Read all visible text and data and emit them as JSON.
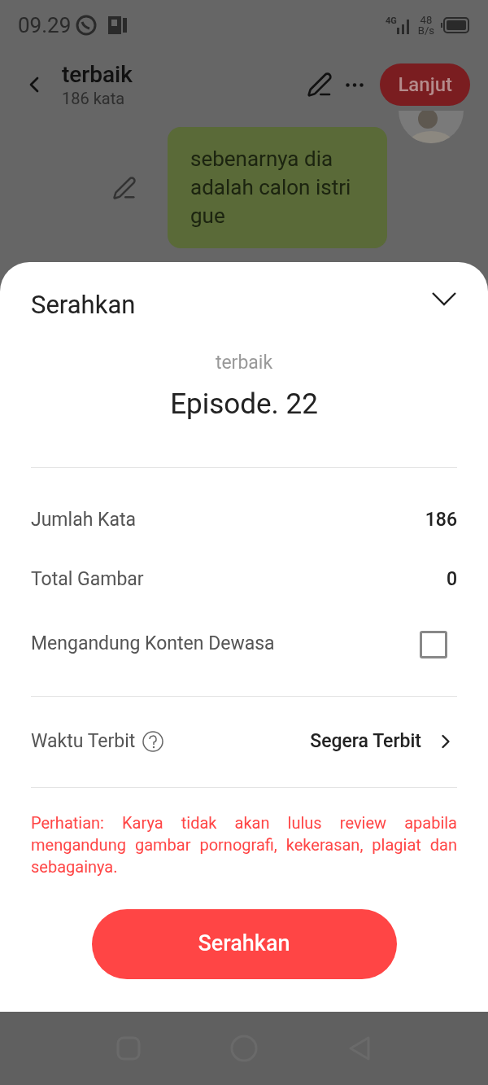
{
  "status_bar": {
    "time": "09.29",
    "network": "4G",
    "speed": "48",
    "speed_unit": "B/s"
  },
  "header": {
    "title": "terbaik",
    "subtitle": "186 kata",
    "action": "Lanjut"
  },
  "message": {
    "text": "sebenarnya dia adalah calon istri gue"
  },
  "sheet": {
    "title": "Serahkan",
    "story": "terbaik",
    "episode": "Episode. 22",
    "rows": [
      {
        "kind": "value",
        "label": "Jumlah Kata",
        "value": "186"
      },
      {
        "kind": "value",
        "label": "Total Gambar",
        "value": "0"
      },
      {
        "kind": "checkbox",
        "label": "Mengandung Konten Dewasa",
        "checked": false
      }
    ],
    "publish": {
      "label": "Waktu Terbit",
      "value": "Segera Terbit"
    },
    "warning": "Perhatian: Karya tidak akan lulus review apabila mengandung gambar pornografi, kekerasan, plagiat dan sebagainya.",
    "submit": "Serahkan"
  }
}
